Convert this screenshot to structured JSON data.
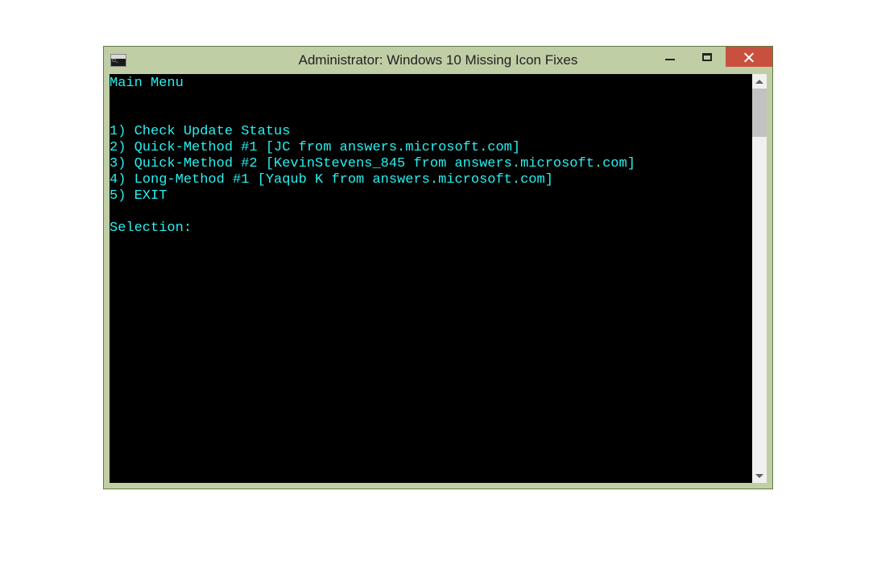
{
  "window": {
    "title": "Administrator:  Windows 10 Missing Icon Fixes"
  },
  "terminal": {
    "header": "Main Menu",
    "menu_items": [
      "1) Check Update Status",
      "2) Quick-Method #1 [JC from answers.microsoft.com]",
      "3) Quick-Method #2 [KevinStevens_845 from answers.microsoft.com]",
      "4) Long-Method #1 [Yaqub K from answers.microsoft.com]",
      "5) EXIT"
    ],
    "prompt": "Selection:"
  },
  "colors": {
    "titlebar_bg": "#c0cea6",
    "terminal_bg": "#000000",
    "terminal_fg": "#27f0f0",
    "close_bg": "#c94f3e"
  }
}
